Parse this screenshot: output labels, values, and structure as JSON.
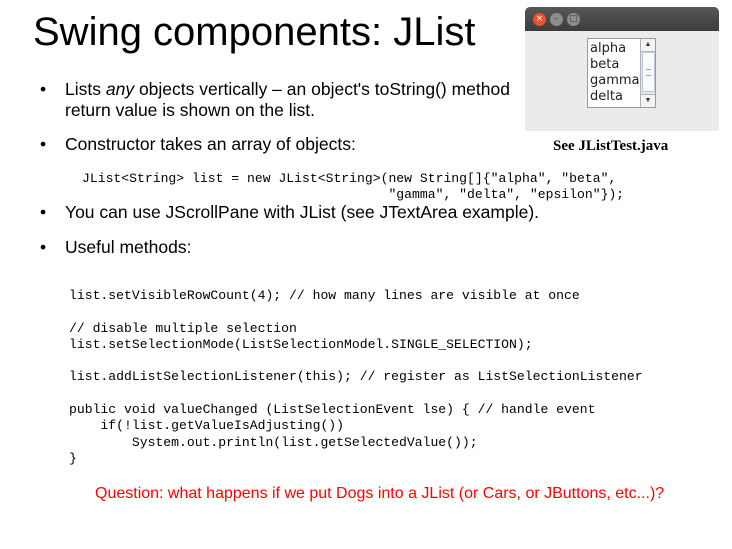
{
  "slide": {
    "title": "Swing components: JList",
    "bullet_glyph": "•",
    "bullets": [
      {
        "pre": "Lists ",
        "em": "any",
        "post": " objects vertically – an object's toString() method return value is shown on the list."
      },
      {
        "text": "Constructor takes an array of objects:"
      },
      {
        "text": "You can use JScrollPane with JList (see JTextArea example)."
      },
      {
        "text": "Useful methods:"
      }
    ],
    "code_constructor": "JList<String> list = new JList<String>(new String[]{\"alpha\", \"beta\",\n                                       \"gamma\", \"delta\", \"epsilon\"});",
    "code_methods": "list.setVisibleRowCount(4); // how many lines are visible at once\n\n// disable multiple selection\nlist.setSelectionMode(ListSelectionModel.SINGLE_SELECTION);\n\nlist.addListSelectionListener(this); // register as ListSelectionListener\n\npublic void valueChanged (ListSelectionEvent lse) { // handle event\n    if(!list.getValueIsAdjusting())\n        System.out.println(list.getSelectedValue());\n}",
    "question": "Question: what happens if we put Dogs into a JList (or Cars, or JButtons, etc...)?",
    "caption": "See JListTest.java"
  },
  "demo_window": {
    "buttons": {
      "close": "×",
      "minimize": "–",
      "maximize": "□"
    },
    "list_items": [
      "alpha",
      "beta",
      "gamma",
      "delta"
    ],
    "scroll_up": "▲",
    "scroll_down": "▼"
  }
}
